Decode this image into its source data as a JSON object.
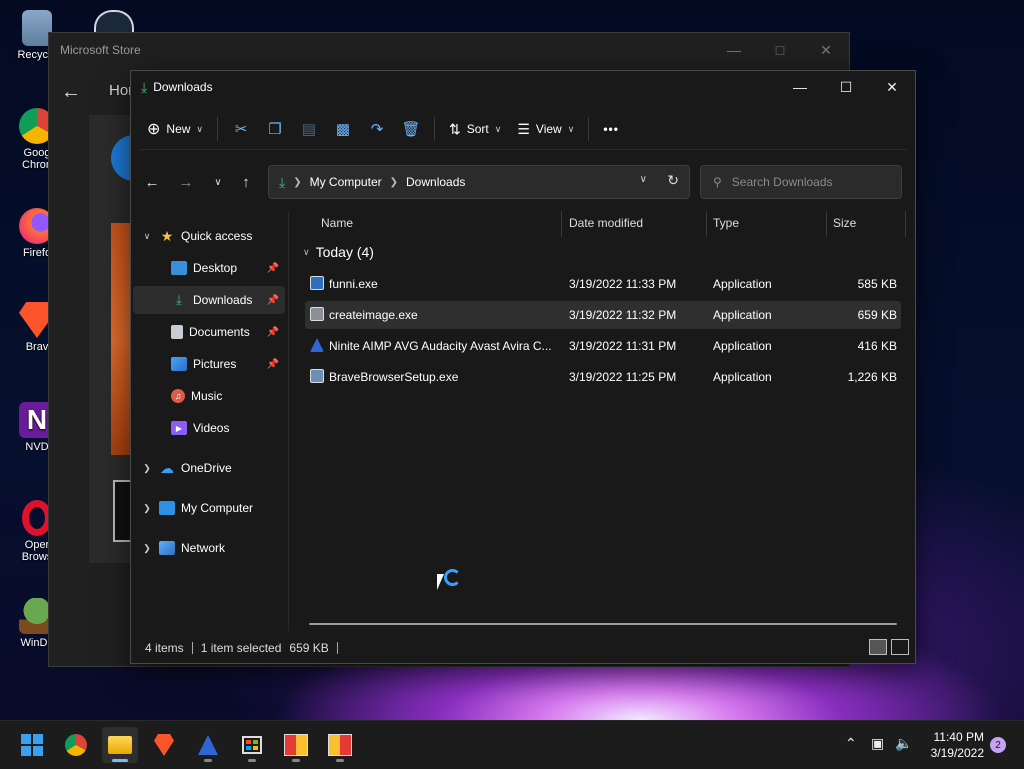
{
  "desktop": {
    "icons": [
      {
        "label": "Recycle"
      },
      {
        "label": "Goog"
      },
      {
        "label": "Chron"
      },
      {
        "label": "Firefo"
      },
      {
        "label": "Brav"
      },
      {
        "label": "NVD"
      },
      {
        "label": "Oper"
      },
      {
        "label": "Brows"
      },
      {
        "label": "WinDir"
      }
    ]
  },
  "store": {
    "title": "Microsoft Store",
    "tab": "Hor"
  },
  "explorer": {
    "title": "Downloads",
    "toolbar": {
      "new_label": "New",
      "sort_label": "Sort",
      "view_label": "View",
      "more_label": "•••"
    },
    "address": {
      "segments": [
        "My Computer",
        "Downloads"
      ]
    },
    "search": {
      "placeholder": "Search Downloads"
    },
    "sidebar": {
      "quick_access": "Quick access",
      "items": [
        {
          "label": "Desktop"
        },
        {
          "label": "Downloads"
        },
        {
          "label": "Documents"
        },
        {
          "label": "Pictures"
        },
        {
          "label": "Music"
        },
        {
          "label": "Videos"
        }
      ],
      "onedrive": "OneDrive",
      "mycomputer": "My Computer",
      "network": "Network"
    },
    "columns": {
      "name": "Name",
      "date": "Date modified",
      "type": "Type",
      "size": "Size"
    },
    "group": "Today (4)",
    "files": [
      {
        "name": "funni.exe",
        "date": "3/19/2022 11:33 PM",
        "type": "Application",
        "size": "585 KB"
      },
      {
        "name": "createimage.exe",
        "date": "3/19/2022 11:32 PM",
        "type": "Application",
        "size": "659 KB"
      },
      {
        "name": "Ninite AIMP AVG Audacity Avast Avira C...",
        "date": "3/19/2022 11:31 PM",
        "type": "Application",
        "size": "416 KB"
      },
      {
        "name": "BraveBrowserSetup.exe",
        "date": "3/19/2022 11:25 PM",
        "type": "Application",
        "size": "1,226 KB"
      }
    ],
    "status": {
      "items": "4 items",
      "selected": "1 item selected",
      "size": "659 KB"
    }
  },
  "taskbar": {
    "time": "11:40 PM",
    "date": "3/19/2022",
    "notifications": "2"
  }
}
